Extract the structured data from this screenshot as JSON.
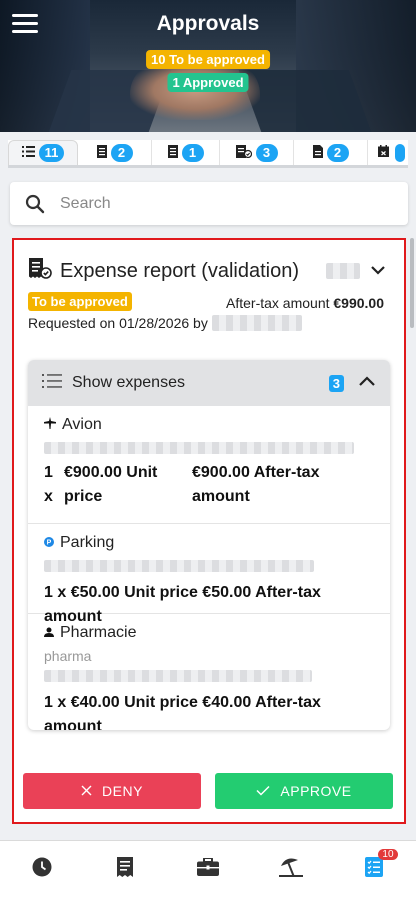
{
  "header": {
    "title": "Approvals",
    "to_be_approved_badge": "10 To be approved",
    "approved_badge": "1 Approved"
  },
  "tabs": [
    {
      "icon": "list-icon",
      "count": "11",
      "active": true
    },
    {
      "icon": "receipt-icon",
      "count": "2"
    },
    {
      "icon": "receipt-icon",
      "count": "1"
    },
    {
      "icon": "receipt-check-icon",
      "count": "3"
    },
    {
      "icon": "document-icon",
      "count": "2"
    },
    {
      "icon": "calendar-icon",
      "count": ""
    }
  ],
  "search": {
    "placeholder": "Search"
  },
  "report": {
    "title": "Expense report (validation)",
    "status": "To be approved",
    "amount_label": "After-tax amount",
    "amount_value": "€990.00",
    "requested_prefix": "Requested on 01/28/2026 by",
    "expenses": {
      "label": "Show expenses",
      "count": "3",
      "items": [
        {
          "icon": "plane-icon",
          "name": "Avion",
          "qty": "1 x",
          "unit_price": "€900.00 Unit price",
          "amount": "€900.00 After-tax amount"
        },
        {
          "icon": "parking-icon",
          "name": "Parking",
          "line": "1 x €50.00 Unit price €50.00 After-tax amount"
        },
        {
          "icon": "person-icon",
          "name": "Pharmacie",
          "sub": "pharma",
          "line": "1 x €40.00 Unit price €40.00 After-tax amount"
        }
      ]
    },
    "deny_label": "DENY",
    "approve_label": "APPROVE"
  },
  "bottom_nav": {
    "items": [
      "clock-icon",
      "receipt-icon",
      "briefcase-icon",
      "beach-umbrella-icon",
      "checklist-icon"
    ],
    "active_index": 4,
    "badge": "10"
  },
  "colors": {
    "accent_blue": "#1ca4f4",
    "warning": "#f4b400",
    "success": "#23cc71",
    "danger": "#ea4157",
    "highlight_border": "#e0191c"
  }
}
